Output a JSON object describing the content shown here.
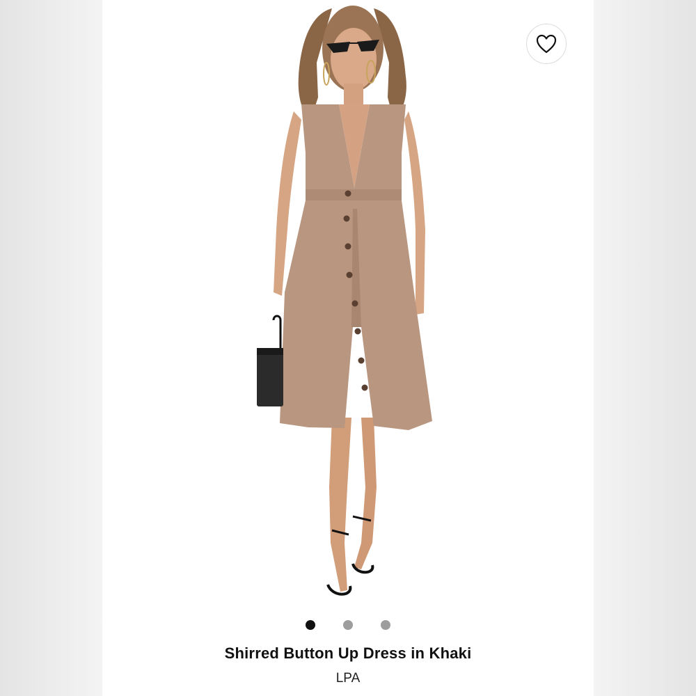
{
  "product": {
    "title": "Shirred Button Up Dress in Khaki",
    "brand": "LPA"
  },
  "favorite": {
    "icon": "heart-outline-icon"
  },
  "gallery": {
    "image_count": 3,
    "active_index": 0
  },
  "colors": {
    "background": "#f4f4f4",
    "card": "#ffffff",
    "dress": "#b89680",
    "dot_active": "#111111",
    "dot_inactive": "#9d9d9d"
  }
}
